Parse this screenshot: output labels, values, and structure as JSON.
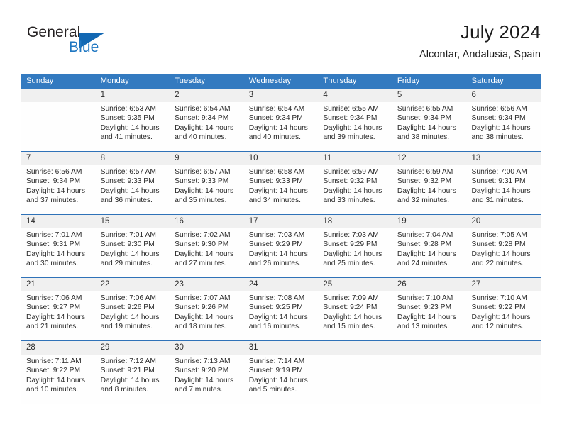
{
  "brand": {
    "name_part1": "General",
    "name_part2": "Blue",
    "flag_icon": "triangle-flag-icon"
  },
  "header": {
    "title": "July 2024",
    "subtitle": "Alcontar, Andalusia, Spain"
  },
  "colors": {
    "header_blue": "#337AC0",
    "week_divider_blue": "#2F72B8",
    "daynum_band": "#F0F0F0",
    "brand_blue": "#1F77C2",
    "text": "#2B2B2B"
  },
  "weekdays": [
    "Sunday",
    "Monday",
    "Tuesday",
    "Wednesday",
    "Thursday",
    "Friday",
    "Saturday"
  ],
  "weeks": [
    [
      {
        "day": "",
        "sunrise": "",
        "sunset": "",
        "daylight": ""
      },
      {
        "day": "1",
        "sunrise": "Sunrise: 6:53 AM",
        "sunset": "Sunset: 9:35 PM",
        "daylight": "Daylight: 14 hours and 41 minutes."
      },
      {
        "day": "2",
        "sunrise": "Sunrise: 6:54 AM",
        "sunset": "Sunset: 9:34 PM",
        "daylight": "Daylight: 14 hours and 40 minutes."
      },
      {
        "day": "3",
        "sunrise": "Sunrise: 6:54 AM",
        "sunset": "Sunset: 9:34 PM",
        "daylight": "Daylight: 14 hours and 40 minutes."
      },
      {
        "day": "4",
        "sunrise": "Sunrise: 6:55 AM",
        "sunset": "Sunset: 9:34 PM",
        "daylight": "Daylight: 14 hours and 39 minutes."
      },
      {
        "day": "5",
        "sunrise": "Sunrise: 6:55 AM",
        "sunset": "Sunset: 9:34 PM",
        "daylight": "Daylight: 14 hours and 38 minutes."
      },
      {
        "day": "6",
        "sunrise": "Sunrise: 6:56 AM",
        "sunset": "Sunset: 9:34 PM",
        "daylight": "Daylight: 14 hours and 38 minutes."
      }
    ],
    [
      {
        "day": "7",
        "sunrise": "Sunrise: 6:56 AM",
        "sunset": "Sunset: 9:34 PM",
        "daylight": "Daylight: 14 hours and 37 minutes."
      },
      {
        "day": "8",
        "sunrise": "Sunrise: 6:57 AM",
        "sunset": "Sunset: 9:33 PM",
        "daylight": "Daylight: 14 hours and 36 minutes."
      },
      {
        "day": "9",
        "sunrise": "Sunrise: 6:57 AM",
        "sunset": "Sunset: 9:33 PM",
        "daylight": "Daylight: 14 hours and 35 minutes."
      },
      {
        "day": "10",
        "sunrise": "Sunrise: 6:58 AM",
        "sunset": "Sunset: 9:33 PM",
        "daylight": "Daylight: 14 hours and 34 minutes."
      },
      {
        "day": "11",
        "sunrise": "Sunrise: 6:59 AM",
        "sunset": "Sunset: 9:32 PM",
        "daylight": "Daylight: 14 hours and 33 minutes."
      },
      {
        "day": "12",
        "sunrise": "Sunrise: 6:59 AM",
        "sunset": "Sunset: 9:32 PM",
        "daylight": "Daylight: 14 hours and 32 minutes."
      },
      {
        "day": "13",
        "sunrise": "Sunrise: 7:00 AM",
        "sunset": "Sunset: 9:31 PM",
        "daylight": "Daylight: 14 hours and 31 minutes."
      }
    ],
    [
      {
        "day": "14",
        "sunrise": "Sunrise: 7:01 AM",
        "sunset": "Sunset: 9:31 PM",
        "daylight": "Daylight: 14 hours and 30 minutes."
      },
      {
        "day": "15",
        "sunrise": "Sunrise: 7:01 AM",
        "sunset": "Sunset: 9:30 PM",
        "daylight": "Daylight: 14 hours and 29 minutes."
      },
      {
        "day": "16",
        "sunrise": "Sunrise: 7:02 AM",
        "sunset": "Sunset: 9:30 PM",
        "daylight": "Daylight: 14 hours and 27 minutes."
      },
      {
        "day": "17",
        "sunrise": "Sunrise: 7:03 AM",
        "sunset": "Sunset: 9:29 PM",
        "daylight": "Daylight: 14 hours and 26 minutes."
      },
      {
        "day": "18",
        "sunrise": "Sunrise: 7:03 AM",
        "sunset": "Sunset: 9:29 PM",
        "daylight": "Daylight: 14 hours and 25 minutes."
      },
      {
        "day": "19",
        "sunrise": "Sunrise: 7:04 AM",
        "sunset": "Sunset: 9:28 PM",
        "daylight": "Daylight: 14 hours and 24 minutes."
      },
      {
        "day": "20",
        "sunrise": "Sunrise: 7:05 AM",
        "sunset": "Sunset: 9:28 PM",
        "daylight": "Daylight: 14 hours and 22 minutes."
      }
    ],
    [
      {
        "day": "21",
        "sunrise": "Sunrise: 7:06 AM",
        "sunset": "Sunset: 9:27 PM",
        "daylight": "Daylight: 14 hours and 21 minutes."
      },
      {
        "day": "22",
        "sunrise": "Sunrise: 7:06 AM",
        "sunset": "Sunset: 9:26 PM",
        "daylight": "Daylight: 14 hours and 19 minutes."
      },
      {
        "day": "23",
        "sunrise": "Sunrise: 7:07 AM",
        "sunset": "Sunset: 9:26 PM",
        "daylight": "Daylight: 14 hours and 18 minutes."
      },
      {
        "day": "24",
        "sunrise": "Sunrise: 7:08 AM",
        "sunset": "Sunset: 9:25 PM",
        "daylight": "Daylight: 14 hours and 16 minutes."
      },
      {
        "day": "25",
        "sunrise": "Sunrise: 7:09 AM",
        "sunset": "Sunset: 9:24 PM",
        "daylight": "Daylight: 14 hours and 15 minutes."
      },
      {
        "day": "26",
        "sunrise": "Sunrise: 7:10 AM",
        "sunset": "Sunset: 9:23 PM",
        "daylight": "Daylight: 14 hours and 13 minutes."
      },
      {
        "day": "27",
        "sunrise": "Sunrise: 7:10 AM",
        "sunset": "Sunset: 9:22 PM",
        "daylight": "Daylight: 14 hours and 12 minutes."
      }
    ],
    [
      {
        "day": "28",
        "sunrise": "Sunrise: 7:11 AM",
        "sunset": "Sunset: 9:22 PM",
        "daylight": "Daylight: 14 hours and 10 minutes."
      },
      {
        "day": "29",
        "sunrise": "Sunrise: 7:12 AM",
        "sunset": "Sunset: 9:21 PM",
        "daylight": "Daylight: 14 hours and 8 minutes."
      },
      {
        "day": "30",
        "sunrise": "Sunrise: 7:13 AM",
        "sunset": "Sunset: 9:20 PM",
        "daylight": "Daylight: 14 hours and 7 minutes."
      },
      {
        "day": "31",
        "sunrise": "Sunrise: 7:14 AM",
        "sunset": "Sunset: 9:19 PM",
        "daylight": "Daylight: 14 hours and 5 minutes."
      },
      {
        "day": "",
        "sunrise": "",
        "sunset": "",
        "daylight": ""
      },
      {
        "day": "",
        "sunrise": "",
        "sunset": "",
        "daylight": ""
      },
      {
        "day": "",
        "sunrise": "",
        "sunset": "",
        "daylight": ""
      }
    ]
  ]
}
